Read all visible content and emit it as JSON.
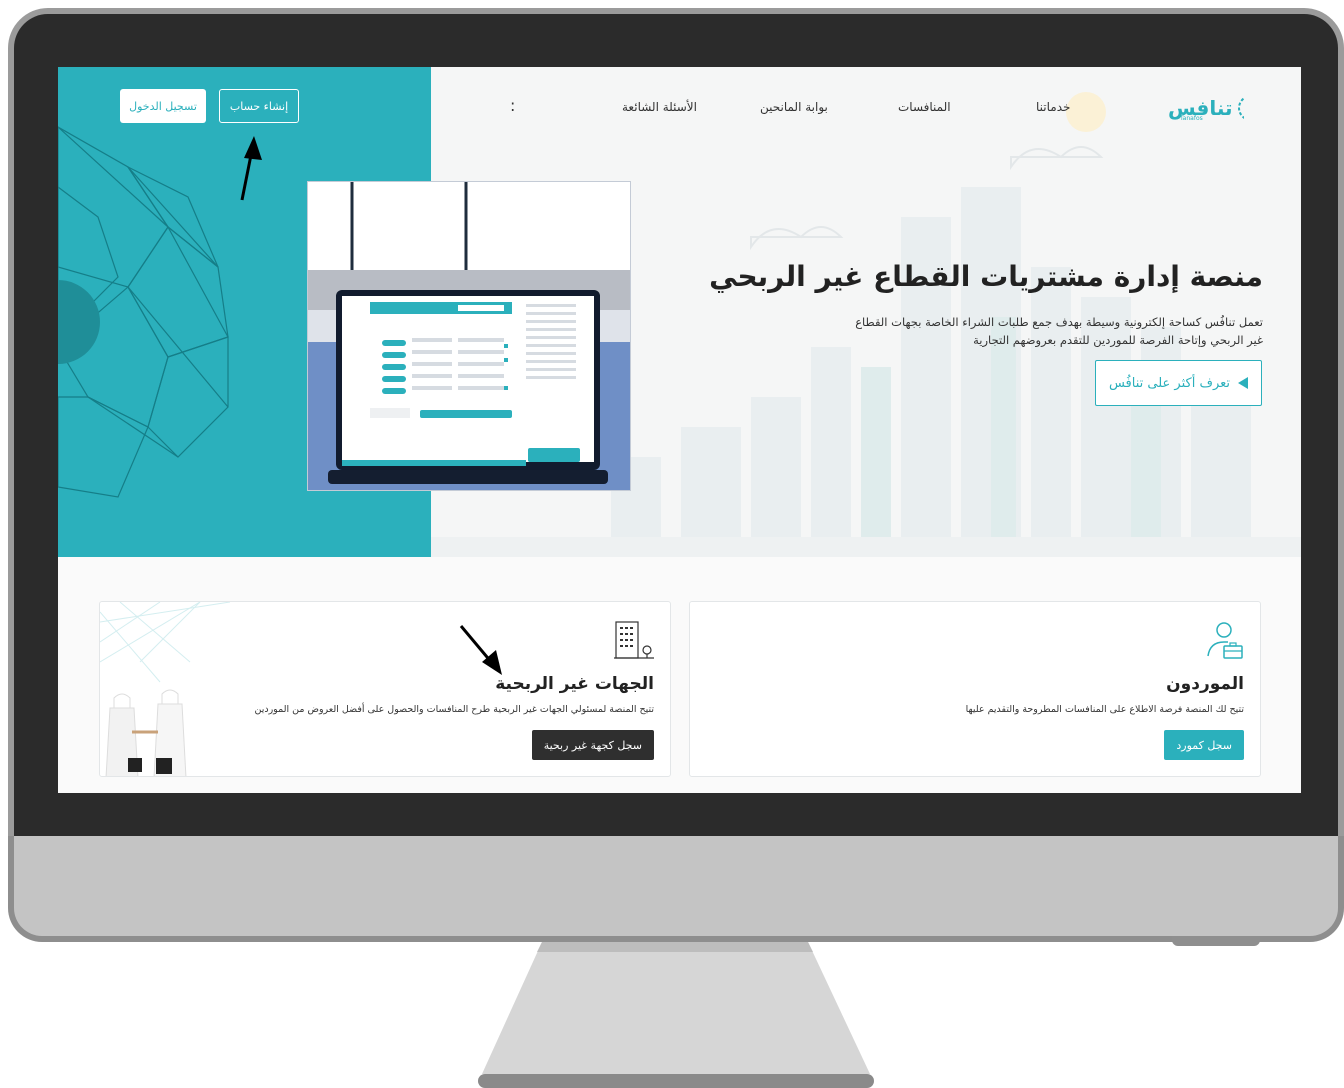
{
  "nav": {
    "logo_text": "تنافس",
    "logo_sub": "Tanafos",
    "items": [
      "خدماتنا",
      "المنافسات",
      "بوابة المانحين",
      "الأسئلة الشائعة"
    ],
    "more": ":",
    "register_label": "إنشاء حساب",
    "login_label": "تسجيل الدخول"
  },
  "hero": {
    "title": "منصة إدارة مشتريات القطاع غير الربحي",
    "description": "تعمل تنافُس كساحة إلكترونية وسيطة بهدف جمع طلبات الشراء الخاصة بجهات القطاع غير الربحي وإتاحة الفرصة للموردين للتقدم بعروضهم التجارية",
    "learn_more_label": "تعرف أكثر على تنافُس"
  },
  "cards": {
    "suppliers": {
      "title": "الموردون",
      "description": "تتيح لك المنصة فرصة الاطلاع على المنافسات المطروحة والتقديم عليها",
      "button_label": "سجل كمورد"
    },
    "nonprofits": {
      "title": "الجهات غير الربحية",
      "description": "تتيح المنصة لمسئولي الجهات غير الربحية طرح المنافسات والحصول على أفضل العروض من الموردين",
      "button_label": "سجل كجهة غير ربحية"
    }
  },
  "colors": {
    "accent": "#2bb0bc",
    "dark_button": "#2f2f2f"
  },
  "icons": [
    "play-icon",
    "supplier-icon",
    "building-icon",
    "logo-icon"
  ]
}
